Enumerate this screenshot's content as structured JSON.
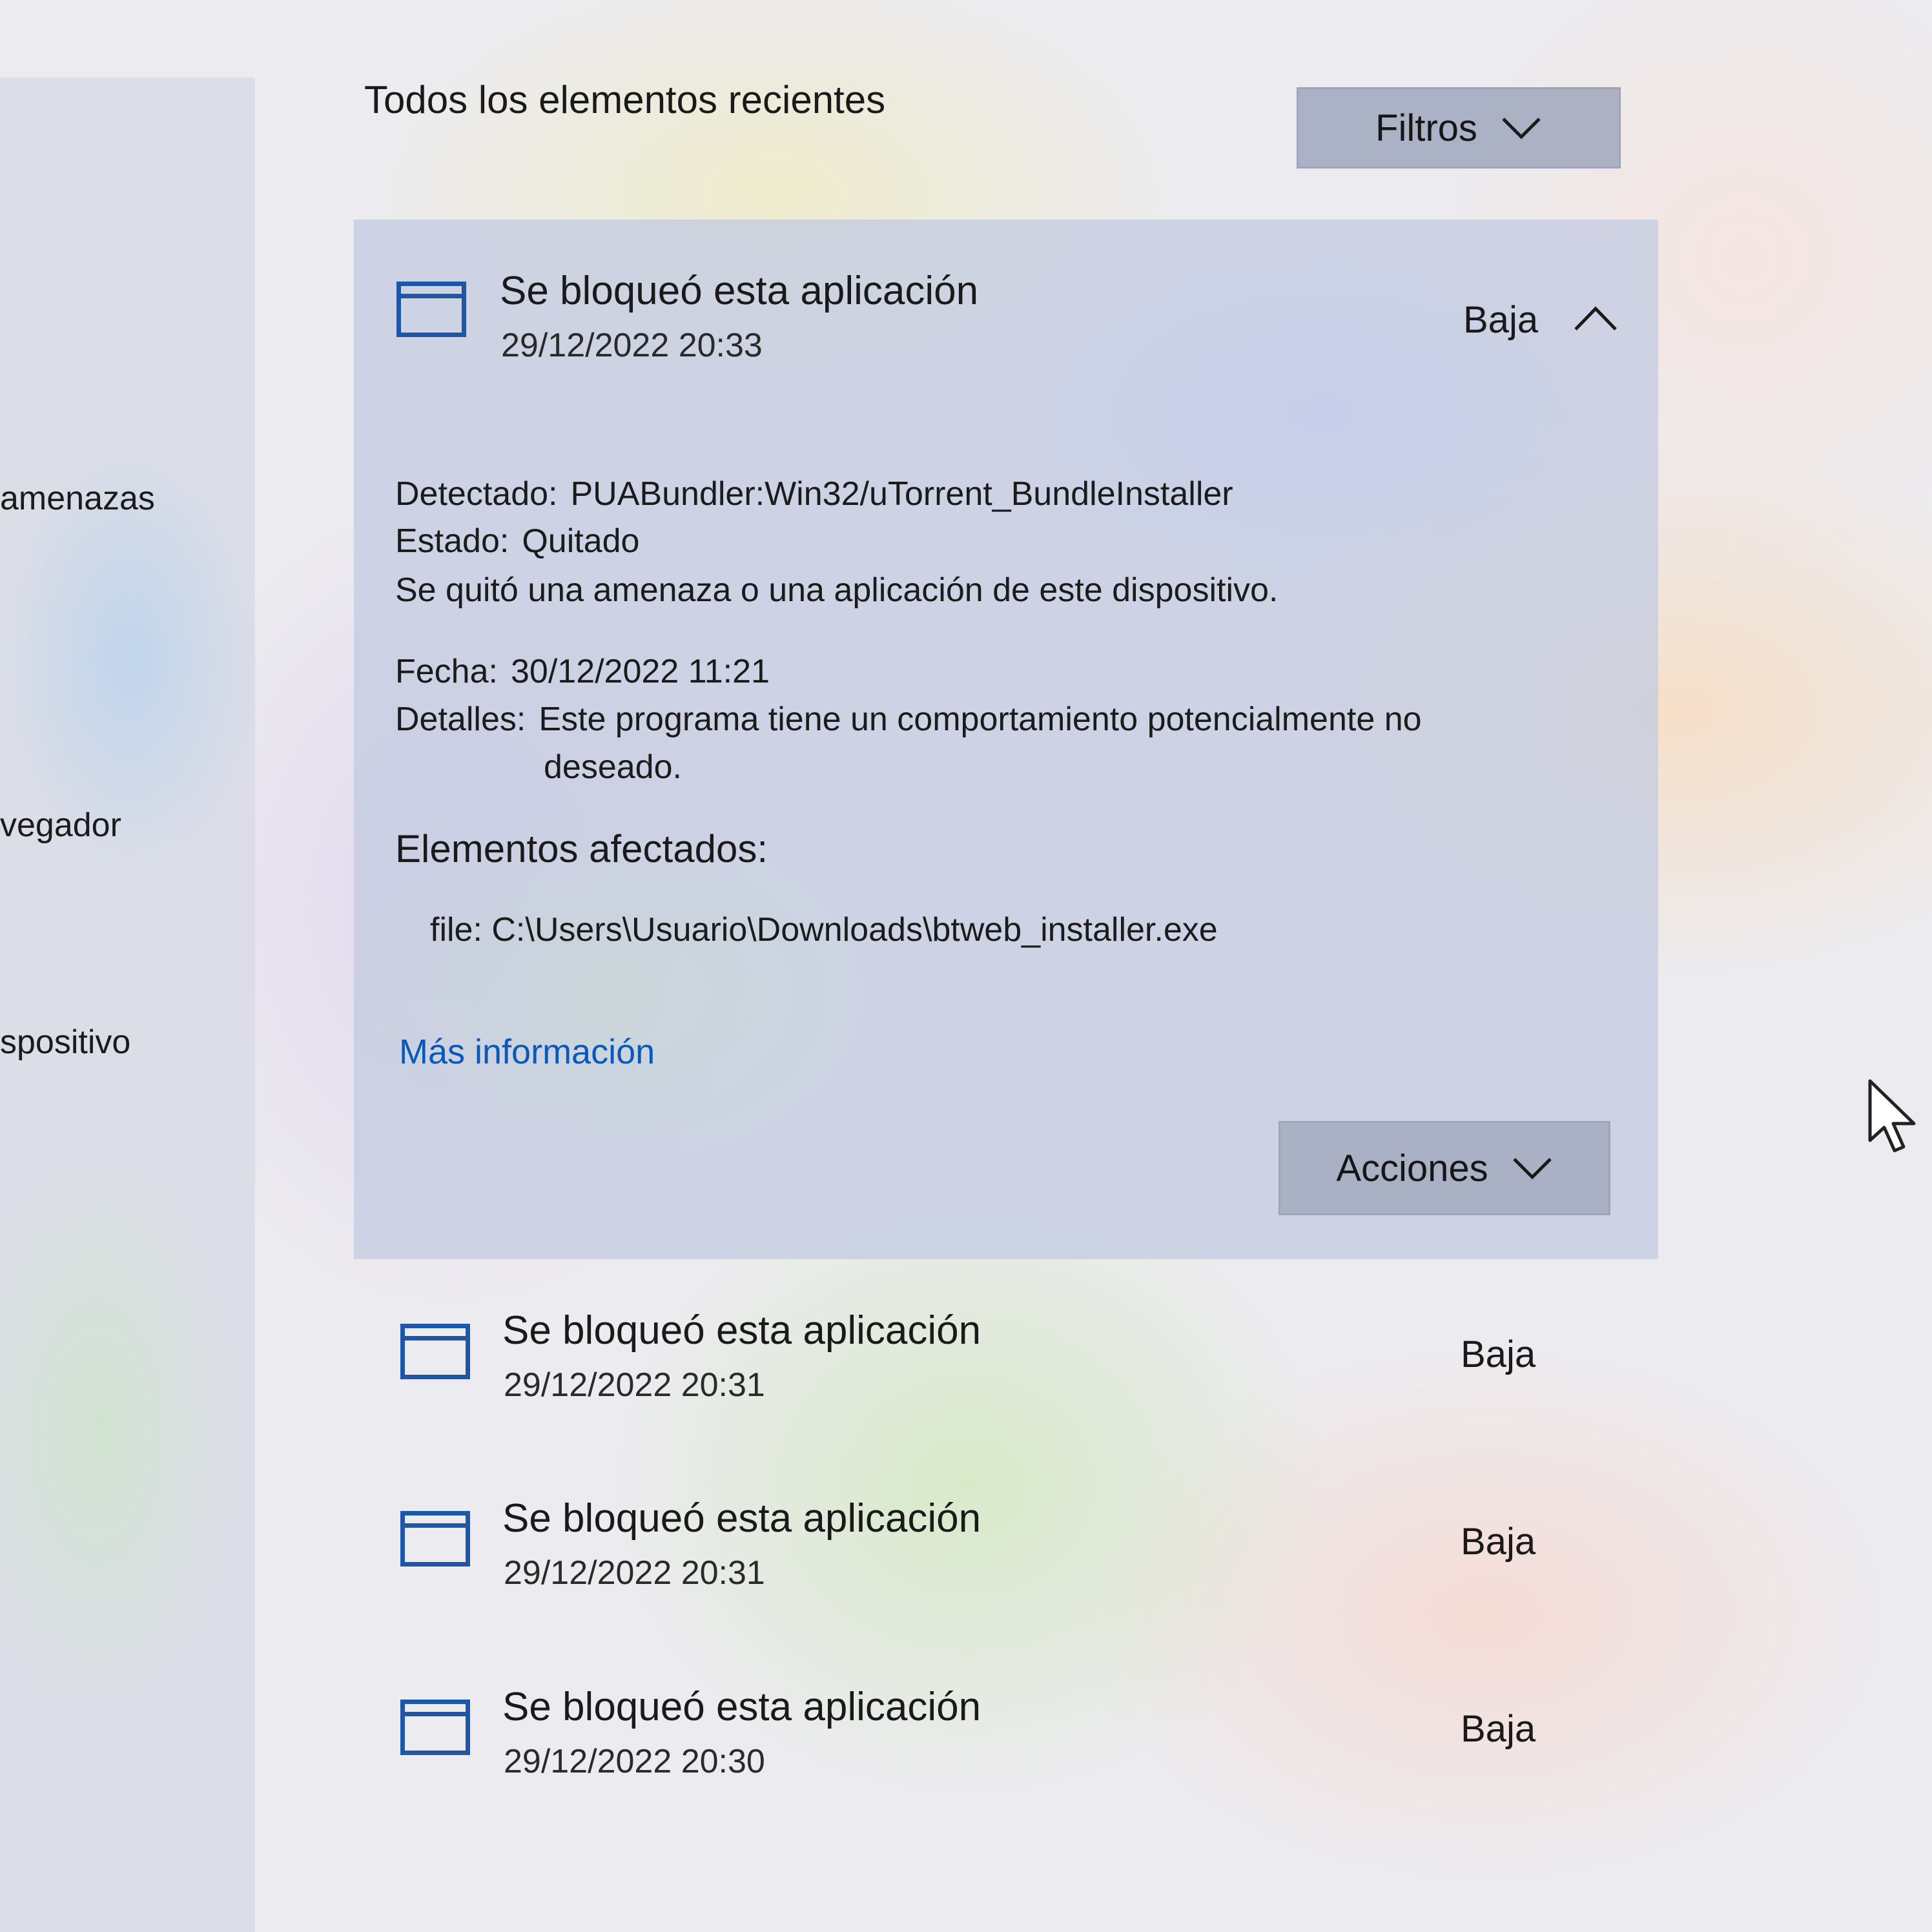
{
  "left_nav": {
    "items": [
      {
        "label": "amenazas"
      },
      {
        "label": "vegador"
      },
      {
        "label": "spositivo"
      }
    ]
  },
  "header": {
    "title": "Todos los elementos recientes",
    "filters_label": "Filtros"
  },
  "expanded_item": {
    "title": "Se bloqueó esta aplicación",
    "date": "29/12/2022 20:33",
    "severity": "Baja",
    "detected_label": "Detectado:",
    "detected_value": "PUABundler:Win32/uTorrent_BundleInstaller",
    "status_label": "Estado:",
    "status_value": "Quitado",
    "status_description": "Se quitó una amenaza o una aplicación de este dispositivo.",
    "date_label": "Fecha:",
    "date_value": "30/12/2022 11:21",
    "details_label": "Detalles:",
    "details_value_line1": "Este programa tiene un comportamiento potencialmente no",
    "details_value_line2": "deseado.",
    "affected_title": "Elementos afectados:",
    "affected_file": "file: C:\\Users\\Usuario\\Downloads\\btweb_installer.exe",
    "more_info_label": "Más información",
    "actions_label": "Acciones"
  },
  "items": [
    {
      "title": "Se bloqueó esta aplicación",
      "date": "29/12/2022 20:31",
      "severity": "Baja"
    },
    {
      "title": "Se bloqueó esta aplicación",
      "date": "29/12/2022 20:31",
      "severity": "Baja"
    },
    {
      "title": "Se bloqueó esta aplicación",
      "date": "29/12/2022 20:30",
      "severity": "Baja"
    }
  ],
  "colors": {
    "accent_blue": "#1f57a8",
    "link_blue": "#0b58b8",
    "button_bg": "#a8afc2"
  },
  "icons": {
    "app_icon": "app-window-icon",
    "expand_icon": "chevron-up-icon",
    "dropdown_icon": "chevron-down-icon",
    "cursor": "mouse-pointer-icon"
  }
}
